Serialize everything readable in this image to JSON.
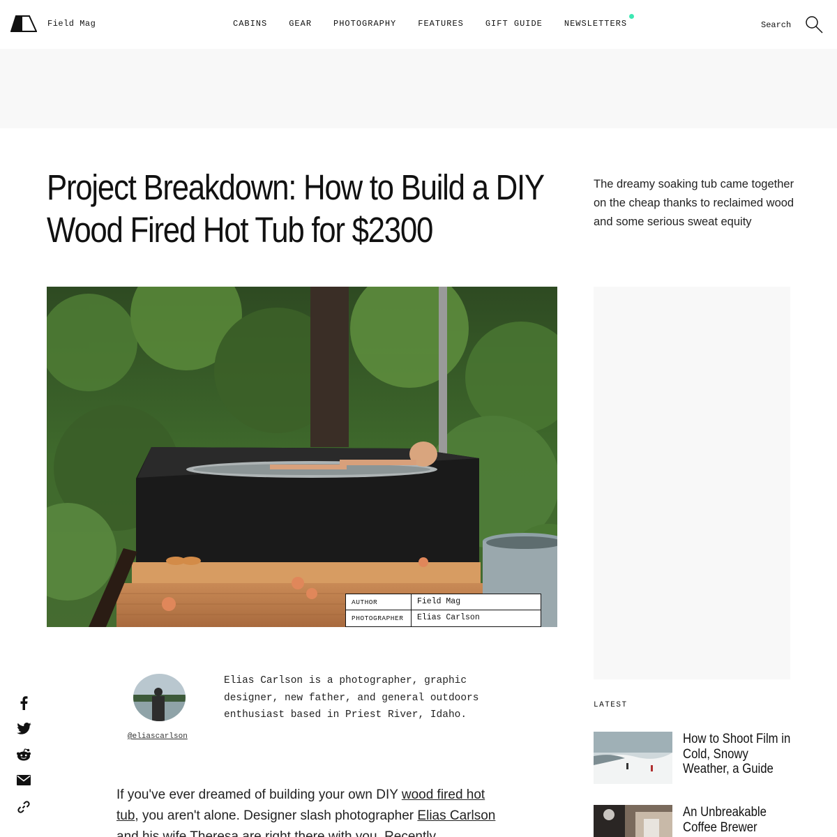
{
  "header": {
    "logo_text": "Field Mag",
    "nav": [
      {
        "label": "CABINS"
      },
      {
        "label": "GEAR"
      },
      {
        "label": "PHOTOGRAPHY"
      },
      {
        "label": "FEATURES"
      },
      {
        "label": "GIFT GUIDE"
      },
      {
        "label": "NEWSLETTERS"
      }
    ],
    "search_label": "Search"
  },
  "article": {
    "title": "Project Breakdown: How to Build a DIY Wood Fired Hot Tub for $2300",
    "dek": "The dreamy soaking tub came together on the cheap thanks to reclaimed wood and some serious sweat equity",
    "credits": {
      "author_key": "AUTHOR",
      "author_val": "Field Mag",
      "photographer_key": "PHOTOGRAPHER",
      "photographer_val": "Elias Carlson"
    },
    "bio": {
      "text": "Elias Carlson is a photographer, graphic designer, new father, and general outdoors enthusiast based in Priest River, Idaho.",
      "handle": "@eliascarlson"
    },
    "body": {
      "p1_a": "If you've ever dreamed of building your own DIY ",
      "p1_link1": "wood fired hot tub",
      "p1_b": ", you aren't alone. Designer slash photographer ",
      "p1_link2": "Elias Carlson",
      "p1_c": " and his wife Theresa are right there with you. Recently"
    }
  },
  "share": [
    "facebook-icon",
    "twitter-icon",
    "reddit-icon",
    "email-icon",
    "link-icon"
  ],
  "latest": {
    "label": "LATEST",
    "items": [
      {
        "title": "How to Shoot Film in Cold, Snowy Weather, a Guide"
      },
      {
        "title": "An Unbreakable Coffee Brewer"
      }
    ]
  },
  "colors": {
    "accent_dot": "#3de8b3",
    "ad_background": "#f8f8f8"
  }
}
